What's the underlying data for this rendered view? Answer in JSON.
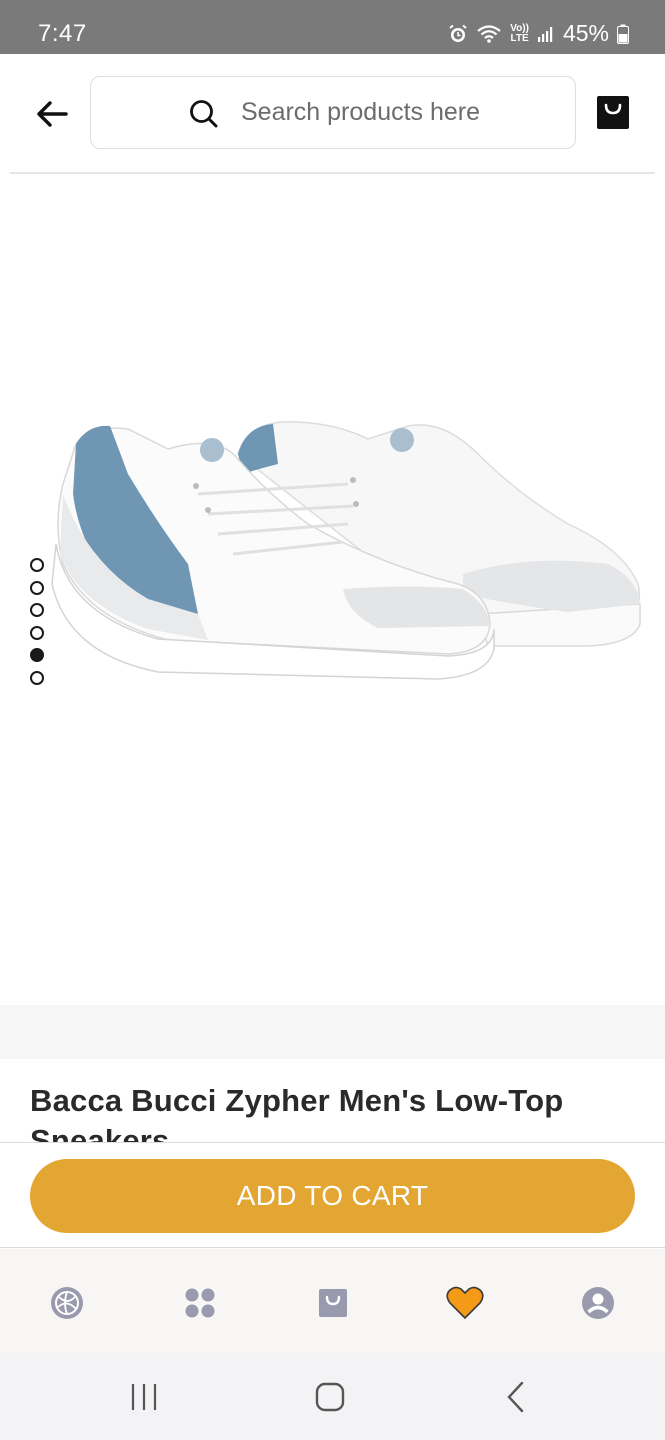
{
  "status_bar": {
    "time": "7:47",
    "network_label_top": "Vo))",
    "network_label_bottom": "LTE",
    "battery": "45%"
  },
  "header": {
    "search": {
      "placeholder": "Search products here",
      "value": ""
    },
    "icons": {
      "back": "arrow-left-icon",
      "search": "search-icon",
      "cart": "shopping-bag-icon"
    }
  },
  "gallery": {
    "slide_count": 6,
    "active_slide": 5,
    "colors": {
      "shoe_accent": "#6f97b3",
      "dot_active": "#1a1a1a"
    }
  },
  "product": {
    "title": "Bacca Bucci Zypher Men's Low-Top Sneakers",
    "wishlist_icon": "heart-icon",
    "wishlist_color": "#e3a632"
  },
  "actions": {
    "add_to_cart_label": "ADD TO CART",
    "accent_color": "#e3a632"
  },
  "bottom_nav": {
    "items": [
      {
        "icon": "home-ball-icon"
      },
      {
        "icon": "categories-icon"
      },
      {
        "icon": "bag-icon"
      },
      {
        "icon": "wishlist-heart-icon",
        "active": true
      },
      {
        "icon": "account-icon"
      }
    ]
  },
  "system_nav": {
    "icons": [
      "recent-apps-icon",
      "home-icon",
      "back-chevron-icon"
    ]
  }
}
